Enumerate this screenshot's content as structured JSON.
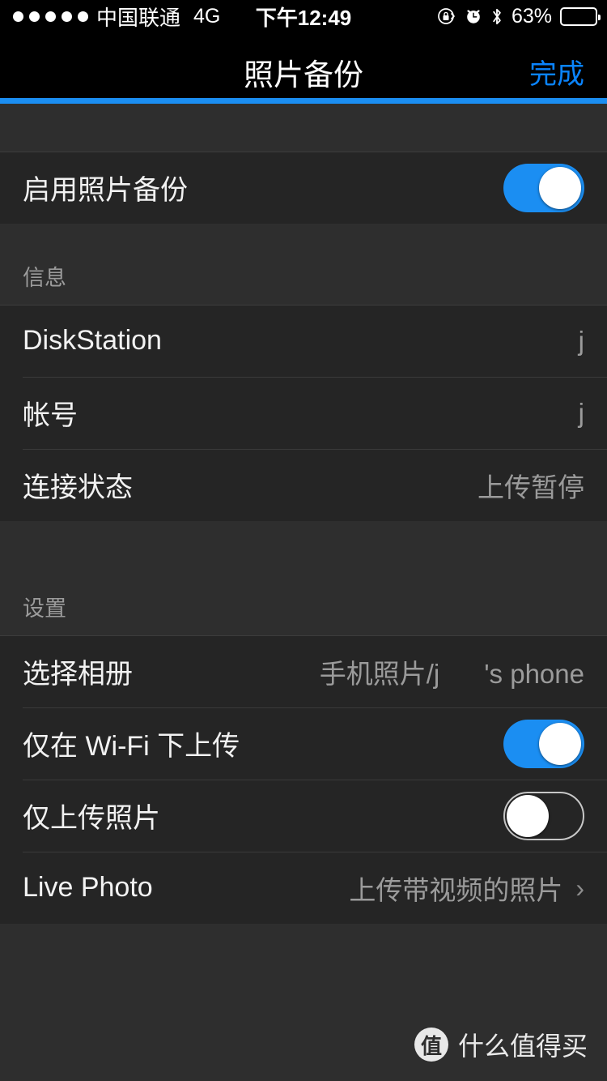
{
  "status_bar": {
    "signal_dots": 5,
    "carrier": "中国联通",
    "network": "4G",
    "time": "下午12:49",
    "battery_percent_label": "63%",
    "battery_level": 63,
    "icons": [
      "rotation-lock-icon",
      "alarm-clock-icon",
      "bluetooth-icon",
      "battery-icon"
    ]
  },
  "nav": {
    "title": "照片备份",
    "done_label": "完成",
    "accent_color": "#0a84ff",
    "progress_color": "#1b8ef2"
  },
  "sections": {
    "enable": {
      "rows": [
        {
          "label": "启用照片备份",
          "control": "toggle",
          "on": true
        }
      ]
    },
    "info": {
      "header": "信息",
      "rows": [
        {
          "label": "DiskStation",
          "value": "j"
        },
        {
          "label": "帐号",
          "value": "j"
        },
        {
          "label": "连接状态",
          "value": "上传暂停"
        }
      ]
    },
    "settings": {
      "header": "设置",
      "rows": [
        {
          "label": "选择相册",
          "value": "手机照片/j      's phone"
        },
        {
          "label": "仅在 Wi-Fi 下上传",
          "control": "toggle",
          "on": true
        },
        {
          "label": "仅上传照片",
          "control": "toggle",
          "on": false
        },
        {
          "label": "Live Photo",
          "value": "上传带视频的照片",
          "chevron": "›"
        }
      ]
    }
  },
  "watermark": {
    "logo_text": "值",
    "text": "什么值得买"
  }
}
